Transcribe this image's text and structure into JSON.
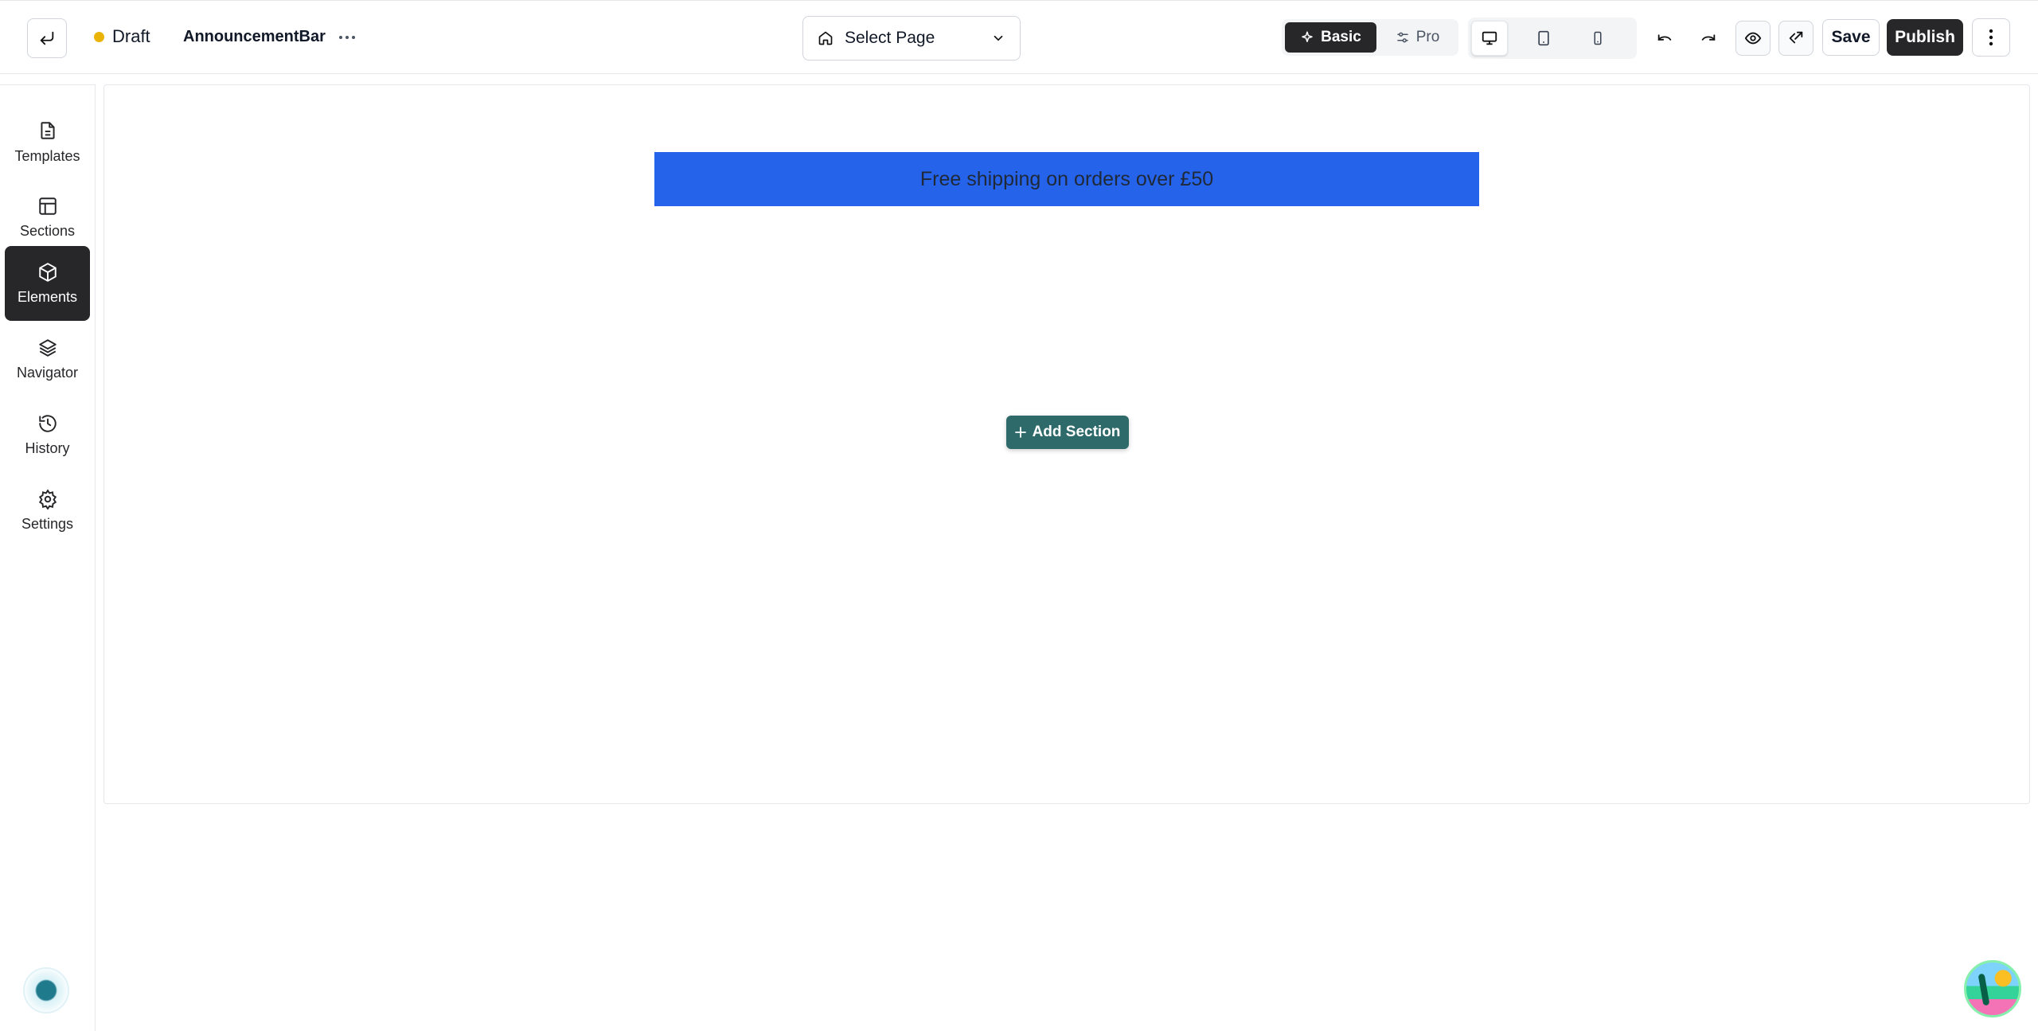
{
  "header": {
    "status": "Draft",
    "status_color": "#eab308",
    "document_name": "AnnouncementBar",
    "page_select": {
      "label": "Select Page",
      "icon": "home-icon"
    },
    "modes": [
      {
        "label": "Basic",
        "icon": "sparkles-icon",
        "active": true
      },
      {
        "label": "Pro",
        "icon": "sliders-icon",
        "active": false
      }
    ],
    "devices": [
      "desktop-icon",
      "tablet-icon",
      "mobile-icon"
    ],
    "save_label": "Save",
    "publish_label": "Publish"
  },
  "sidebar": {
    "items": [
      {
        "label": "Templates",
        "icon": "file-icon"
      },
      {
        "label": "Sections",
        "icon": "layout-icon"
      },
      {
        "label": "Elements",
        "icon": "box-icon",
        "active": true
      },
      {
        "label": "Navigator",
        "icon": "layers-icon"
      },
      {
        "label": "History",
        "icon": "history-icon"
      },
      {
        "label": "Settings",
        "icon": "gear-icon"
      }
    ]
  },
  "canvas": {
    "announcement_text": "Free shipping on orders over £50",
    "announcement_bg": "#2563eb",
    "add_section_label": "Add Section",
    "add_section_color": "#2f6a6a"
  },
  "colors": {
    "primary_dark": "#27272a"
  }
}
